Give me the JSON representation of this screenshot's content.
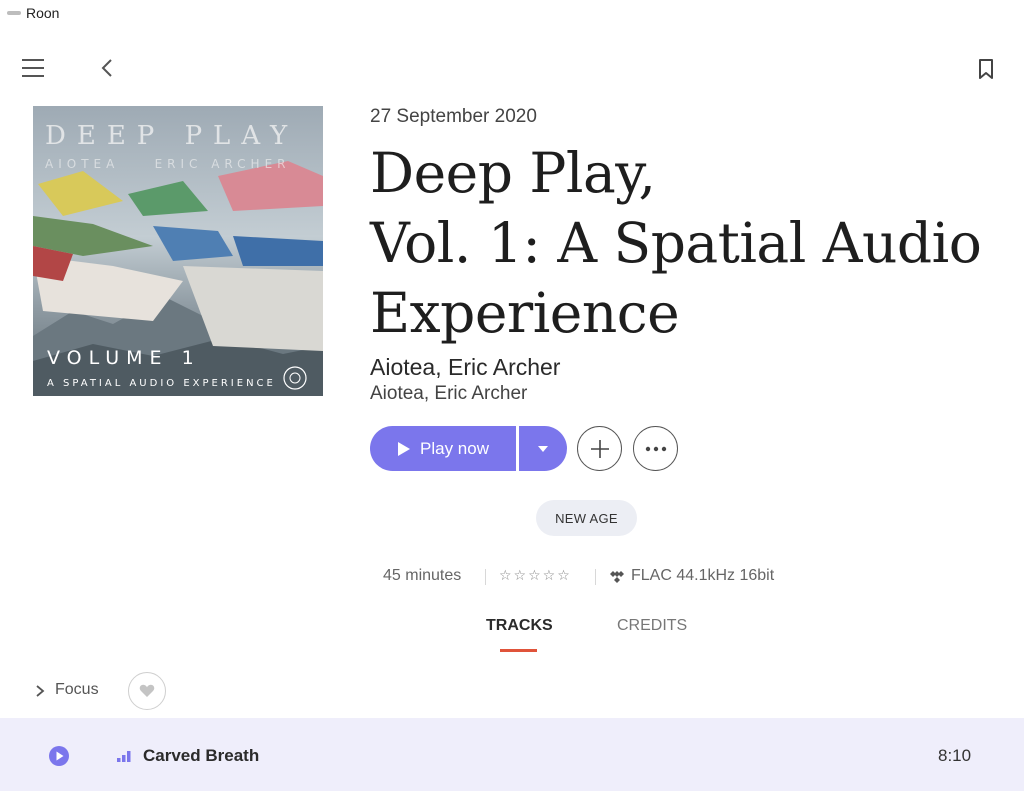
{
  "window": {
    "title": "Roon"
  },
  "nav": {
    "menu_icon": "hamburger-icon",
    "back_icon": "chevron-left-icon",
    "bookmark_icon": "bookmark-icon"
  },
  "album": {
    "release_date": "27 September 2020",
    "title_lines": [
      "Deep Play,",
      "Vol. 1: A Spatial Audio",
      "Experience"
    ],
    "artist_primary": "Aiotea, Eric Archer",
    "artist_secondary": "Aiotea, Eric Archer",
    "cover": {
      "title": "DEEP PLAY",
      "artists": "AIOTEA    ERIC ARCHER",
      "volume": "VOLUME 1",
      "subtitle": "A SPATIAL AUDIO EXPERIENCE"
    }
  },
  "actions": {
    "play_label": "Play now",
    "play_icon": "play-icon",
    "dropdown_icon": "caret-down-icon",
    "add_icon": "plus-icon",
    "more_icon": "ellipsis-icon"
  },
  "genre": {
    "label": "NEW AGE"
  },
  "meta": {
    "duration": "45 minutes",
    "stars": "☆☆☆☆☆",
    "format_icon": "tidal-icon",
    "format": "FLAC 44.1kHz 16bit"
  },
  "tabs": [
    {
      "label": "TRACKS",
      "active": true
    },
    {
      "label": "CREDITS",
      "active": false
    }
  ],
  "focus": {
    "label": "Focus",
    "heart_icon": "heart-icon"
  },
  "tracks": [
    {
      "title": "Carved Breath",
      "duration": "8:10"
    }
  ],
  "colors": {
    "accent": "#7b76ec",
    "tab_indicator": "#e0533a",
    "row_highlight": "#efeefb",
    "pill_bg": "#eceef4"
  }
}
